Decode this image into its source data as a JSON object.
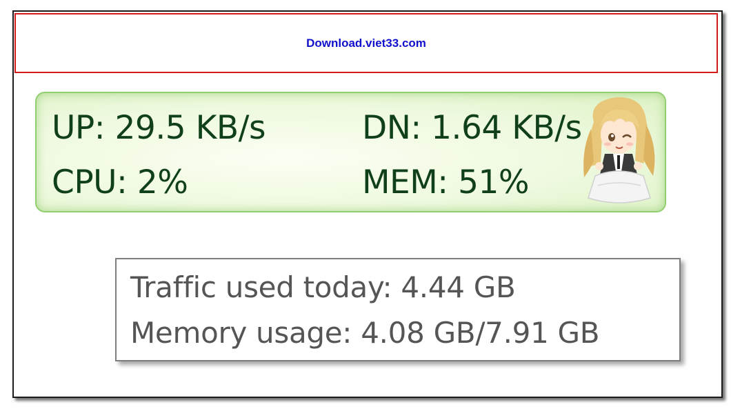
{
  "watermark": {
    "text": "Download.viet33.com"
  },
  "monitor": {
    "upload": "UP: 29.5 KB/s",
    "download": "DN: 1.64 KB/s",
    "cpu": "CPU: 2%",
    "memory": "MEM: 51%",
    "mascot_icon": "anime-girl-mascot-icon"
  },
  "tooltip": {
    "traffic": "Traffic used today: 4.44 GB",
    "memory_usage": "Memory usage: 4.08 GB/7.91 GB"
  },
  "colors": {
    "watermark_border": "#d21a1a",
    "watermark_text": "#1010cc",
    "monitor_border": "#8fcf6f",
    "monitor_text": "#10401a",
    "tooltip_text": "#555555"
  }
}
